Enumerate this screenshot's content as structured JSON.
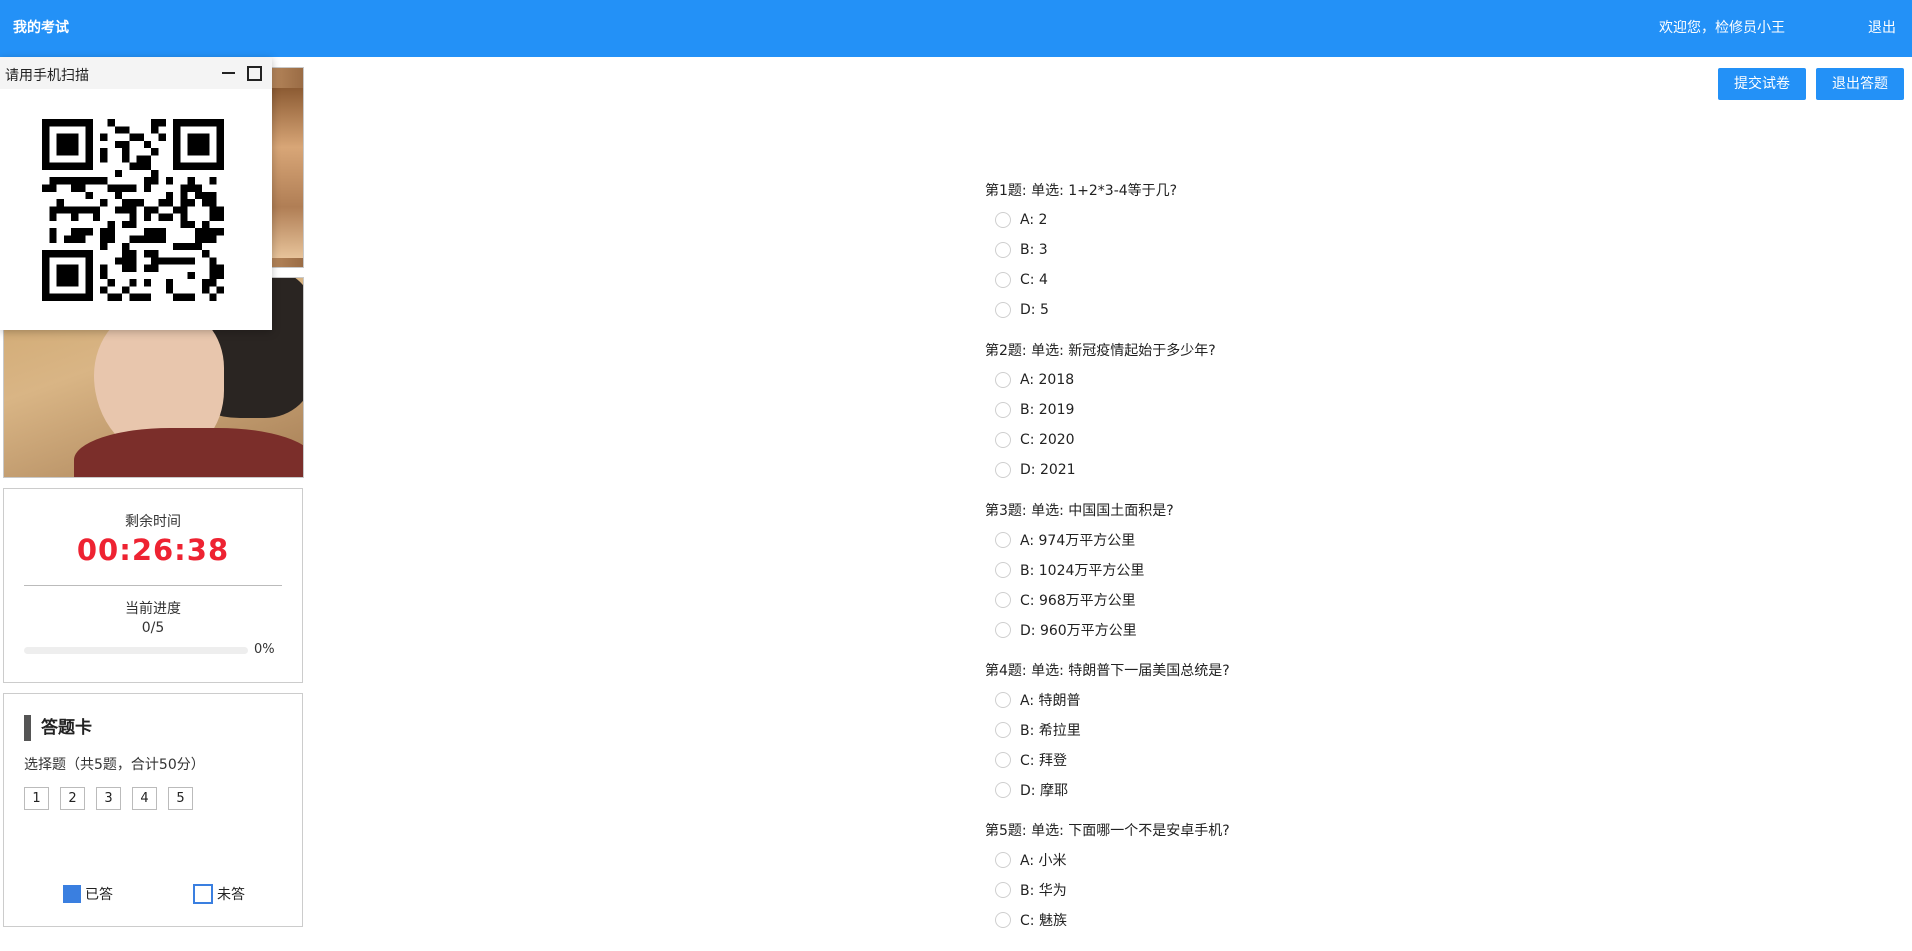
{
  "header": {
    "title": "我的考试",
    "welcome": "欢迎您，检修员小王",
    "logout": "退出"
  },
  "qr_panel": {
    "title": "请用手机扫描"
  },
  "timer": {
    "remaining_label": "剩余时间",
    "remaining": "00:26:38",
    "progress_label": "当前进度",
    "progress_count": "0/5",
    "progress_percent": "0%",
    "progress_value": 0
  },
  "answer_card": {
    "title": "答题卡",
    "subtitle": "选择题（共5题，合计50分）",
    "numbers": [
      "1",
      "2",
      "3",
      "4",
      "5"
    ],
    "legend_answered": "已答",
    "legend_unanswered": "未答"
  },
  "actions": {
    "submit": "提交试卷",
    "exit": "退出答题"
  },
  "questions": [
    {
      "text": "第1题: 单选: 1+2*3-4等于几?",
      "options": [
        "A: 2",
        "B: 3",
        "C: 4",
        "D: 5"
      ]
    },
    {
      "text": "第2题: 单选: 新冠疫情起始于多少年?",
      "options": [
        "A: 2018",
        "B: 2019",
        "C: 2020",
        "D: 2021"
      ]
    },
    {
      "text": "第3题: 单选: 中国国土面积是?",
      "options": [
        "A: 974万平方公里",
        "B: 1024万平方公里",
        "C: 968万平方公里",
        "D: 960万平方公里"
      ]
    },
    {
      "text": "第4题: 单选: 特朗普下一届美国总统是?",
      "options": [
        "A: 特朗普",
        "B: 希拉里",
        "C: 拜登",
        "D: 摩耶"
      ]
    },
    {
      "text": "第5题: 单选: 下面哪一个不是安卓手机?",
      "options": [
        "A: 小米",
        "B: 华为",
        "C: 魅族"
      ]
    }
  ]
}
